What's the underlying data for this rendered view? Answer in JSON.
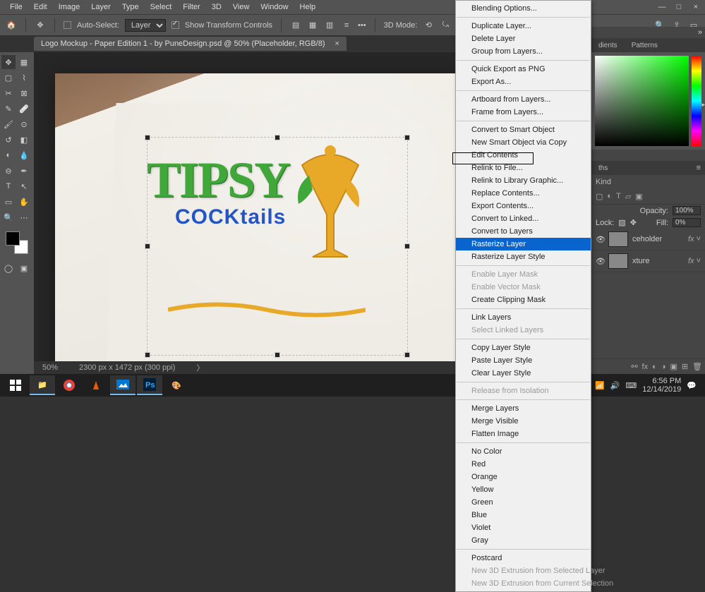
{
  "menubar": {
    "items": [
      "File",
      "Edit",
      "Image",
      "Layer",
      "Type",
      "Select",
      "Filter",
      "3D",
      "View",
      "Window",
      "Help"
    ]
  },
  "win": {
    "min": "—",
    "max": "□",
    "close": "×"
  },
  "optbar": {
    "auto_select": "Auto-Select:",
    "layer_dd": "Layer",
    "show_tc": "Show Transform Controls",
    "mode_label": "3D Mode:"
  },
  "doctab": {
    "title": "Logo Mockup - Paper Edition 1 - by PuneDesign.psd @ 50% (Placeholder, RGB/8)",
    "close": "×"
  },
  "status": {
    "zoom": "50%",
    "dims": "2300 px x 1472 px (300 ppi)"
  },
  "ctx": [
    {
      "t": "Blending Options..."
    },
    {
      "sep": 1
    },
    {
      "t": "Duplicate Layer..."
    },
    {
      "t": "Delete Layer"
    },
    {
      "t": "Group from Layers..."
    },
    {
      "sep": 1
    },
    {
      "t": "Quick Export as PNG"
    },
    {
      "t": "Export As..."
    },
    {
      "sep": 1
    },
    {
      "t": "Artboard from Layers..."
    },
    {
      "t": "Frame from Layers..."
    },
    {
      "sep": 1
    },
    {
      "t": "Convert to Smart Object"
    },
    {
      "t": "New Smart Object via Copy"
    },
    {
      "t": "Edit Contents"
    },
    {
      "t": "Relink to File..."
    },
    {
      "t": "Relink to Library Graphic..."
    },
    {
      "t": "Replace Contents..."
    },
    {
      "t": "Export Contents..."
    },
    {
      "t": "Convert to Linked..."
    },
    {
      "t": "Convert to Layers"
    },
    {
      "t": "Rasterize Layer",
      "hl": 1
    },
    {
      "t": "Rasterize Layer Style"
    },
    {
      "sep": 1
    },
    {
      "t": "Enable Layer Mask",
      "d": 1
    },
    {
      "t": "Enable Vector Mask",
      "d": 1
    },
    {
      "t": "Create Clipping Mask"
    },
    {
      "sep": 1
    },
    {
      "t": "Link Layers"
    },
    {
      "t": "Select Linked Layers",
      "d": 1
    },
    {
      "sep": 1
    },
    {
      "t": "Copy Layer Style"
    },
    {
      "t": "Paste Layer Style"
    },
    {
      "t": "Clear Layer Style"
    },
    {
      "sep": 1
    },
    {
      "t": "Release from Isolation",
      "d": 1
    },
    {
      "sep": 1
    },
    {
      "t": "Merge Layers"
    },
    {
      "t": "Merge Visible"
    },
    {
      "t": "Flatten Image"
    },
    {
      "sep": 1
    },
    {
      "t": "No Color"
    },
    {
      "t": "Red"
    },
    {
      "t": "Orange"
    },
    {
      "t": "Yellow"
    },
    {
      "t": "Green"
    },
    {
      "t": "Blue"
    },
    {
      "t": "Violet"
    },
    {
      "t": "Gray"
    },
    {
      "sep": 1
    },
    {
      "t": "Postcard"
    },
    {
      "t": "New 3D Extrusion from Selected Layer",
      "d": 1
    },
    {
      "t": "New 3D Extrusion from Current Selection",
      "d": 1
    }
  ],
  "right": {
    "tabs1": [
      "dients",
      "Patterns"
    ],
    "tabs2": [
      "ths"
    ],
    "kind": "Kind",
    "opacity_lbl": "Opacity:",
    "opacity_val": "100%",
    "fill_lbl": "Fill:",
    "fill_val": "0%",
    "layer1": "ceholder",
    "layer2": "xture",
    "lock": "Lock:"
  },
  "logo": {
    "l1": "TIPSY",
    "l2": "COCKtails"
  },
  "taskbar": {
    "time": "6:56 PM",
    "date": "12/14/2019"
  }
}
